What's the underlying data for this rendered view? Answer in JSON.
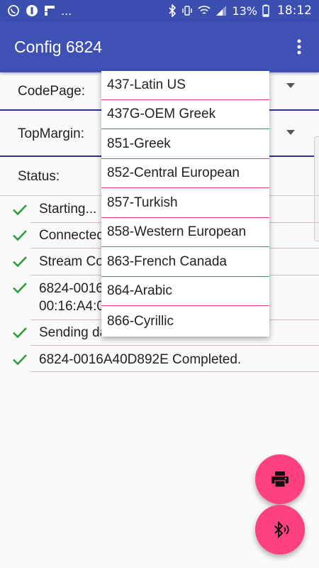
{
  "status_bar": {
    "left_icons": [
      "whatsapp-icon",
      "blocked-icon",
      "flipboard-icon"
    ],
    "ellipsis": "...",
    "battery": "13%",
    "time": "18:12"
  },
  "app_bar": {
    "title": "Config 6824"
  },
  "form": {
    "codepage_label": "CodePage:",
    "topmargin_label": "TopMargin:",
    "status_label": "Status:"
  },
  "log": [
    {
      "text": "Starting..."
    },
    {
      "text": "Connected"
    },
    {
      "text": "Stream Co"
    },
    {
      "text_line1": "6824-0016",
      "text_line2": "00:16:A4:0"
    },
    {
      "text": "Sending data..."
    },
    {
      "text": "6824-0016A40D892E Completed."
    }
  ],
  "dropdown": {
    "items": [
      "437-Latin US",
      "437G-OEM Greek",
      "851-Greek",
      "852-Central European",
      "857-Turkish",
      "858-Western European",
      "863-French Canada",
      "864-Arabic",
      "866-Cyrillic"
    ]
  },
  "colors": {
    "primary": "#3f51b5",
    "primary_dark": "#3b4fb0",
    "accent": "#ff4081",
    "check": "#2e9e3a"
  }
}
